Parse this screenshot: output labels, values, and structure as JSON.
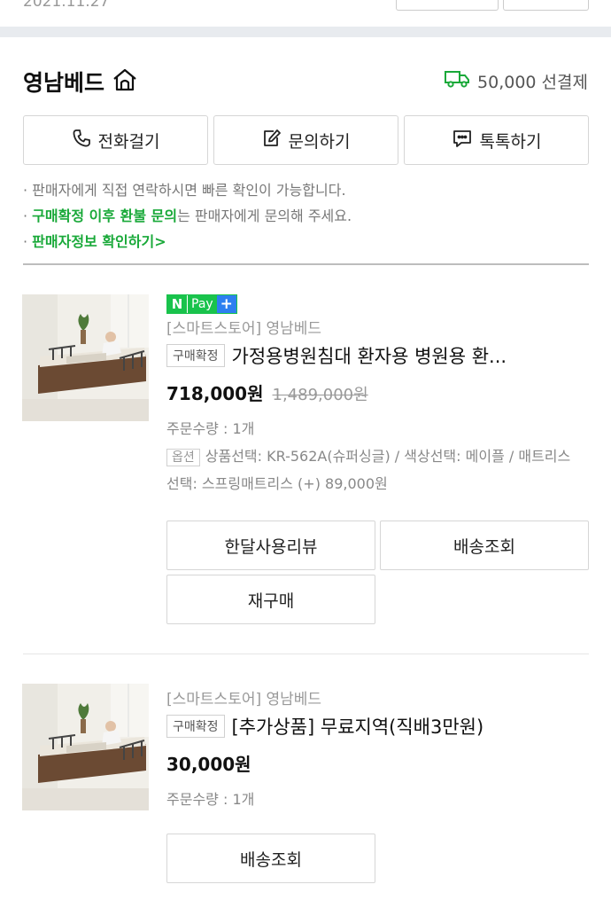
{
  "top": {
    "date": "2021.11.27"
  },
  "seller": {
    "name": "영남베드",
    "shipping_fee": "50,000 선결제",
    "actions": [
      {
        "label": "전화걸기",
        "icon": "phone-icon"
      },
      {
        "label": "문의하기",
        "icon": "edit-icon"
      },
      {
        "label": "톡톡하기",
        "icon": "chat-icon"
      }
    ],
    "notes": {
      "line1": "판매자에게 직접 연락하시면 빠른 확인이 가능합니다.",
      "line2_highlight": "구매확정 이후 환불 문의",
      "line2_rest": "는 판매자에게 문의해 주세요.",
      "line3": "판매자정보 확인하기>"
    }
  },
  "orders": [
    {
      "npay": {
        "n": "N",
        "pay": "Pay",
        "plus": "+"
      },
      "store": "[스마트스토어] 영남베드",
      "status_badge": "구매확정",
      "title": "가정용병원침대 환자용 병원용 환...",
      "price": "718,000원",
      "original_price": "1,489,000원",
      "quantity": "주문수량 : 1개",
      "option_badge": "옵션",
      "option_text": "상품선택: KR-562A(슈퍼싱글) / 색상선택: 메이플 / 매트리스선택: 스프링매트리스 (+) 89,000원",
      "buttons": [
        "한달사용리뷰",
        "배송조회",
        "재구매"
      ]
    },
    {
      "store": "[스마트스토어] 영남베드",
      "status_badge": "구매확정",
      "title": "[추가상품] 무료지역(직배3만원)",
      "price": "30,000원",
      "quantity": "주문수량 : 1개",
      "buttons": [
        "배송조회"
      ]
    }
  ],
  "colors": {
    "accent_green": "#19a939",
    "npay_green": "#19c34c",
    "npay_blue": "#2d7ff0"
  }
}
